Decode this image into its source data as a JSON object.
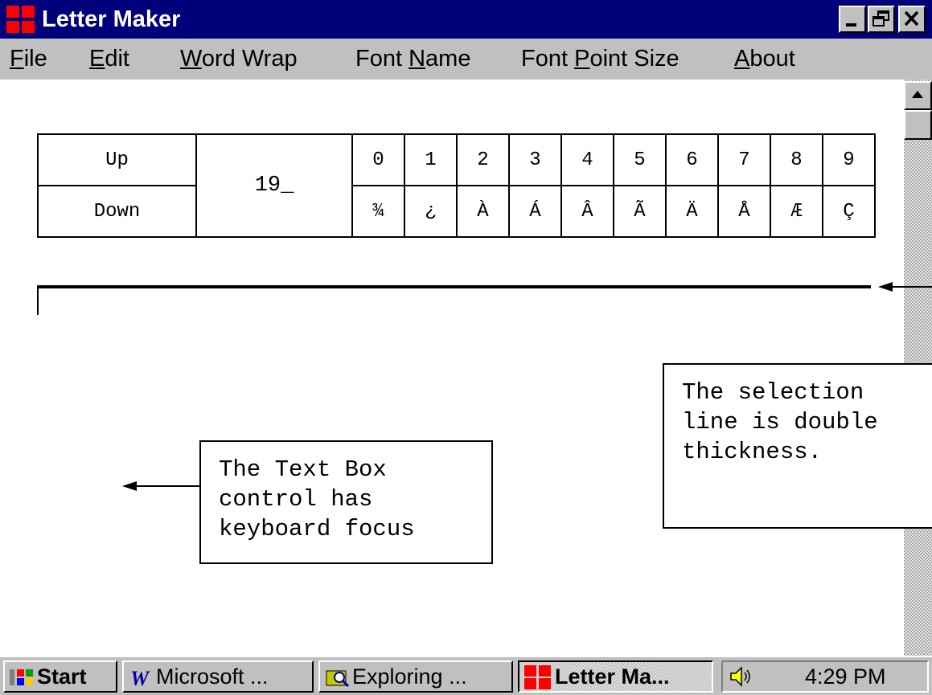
{
  "window": {
    "title": "Letter Maker",
    "controls": [
      "minimize",
      "restore",
      "close"
    ]
  },
  "menu": [
    {
      "text": "File",
      "underline": "F",
      "rest": "ile"
    },
    {
      "text": "Edit",
      "underline": "E",
      "rest": "dit"
    },
    {
      "text": "Word Wrap",
      "underline": "W",
      "rest": "ord Wrap"
    },
    {
      "text": "Font Name",
      "pre": "Font ",
      "underline": "N",
      "rest": "ame"
    },
    {
      "text": "Font Point Size",
      "pre": "Font ",
      "underline": "P",
      "rest": "oint Size"
    },
    {
      "text": "About",
      "underline": "A",
      "rest": "bout"
    }
  ],
  "char_table": {
    "up_label": "Up",
    "down_label": "Down",
    "code": "19_",
    "digits": [
      "0",
      "1",
      "2",
      "3",
      "4",
      "5",
      "6",
      "7",
      "8",
      "9"
    ],
    "chars": [
      "¾",
      "¿",
      "À",
      "Á",
      "Â",
      "Ã",
      "Ä",
      "Å",
      "Æ",
      "Ç"
    ]
  },
  "callouts": {
    "selection": "The selection\nline is double\nthickness.",
    "textbox": "The Text Box\ncontrol has\nkeyboard focus"
  },
  "taskbar": {
    "start": "Start",
    "tasks": [
      "Microsoft ...",
      "Exploring ...",
      "Letter Ma..."
    ],
    "clock": "4:29 PM"
  },
  "colors": {
    "title_bar": "#00007b",
    "chrome": "#c0c0c0",
    "app_icon_red": "#ff0000"
  }
}
